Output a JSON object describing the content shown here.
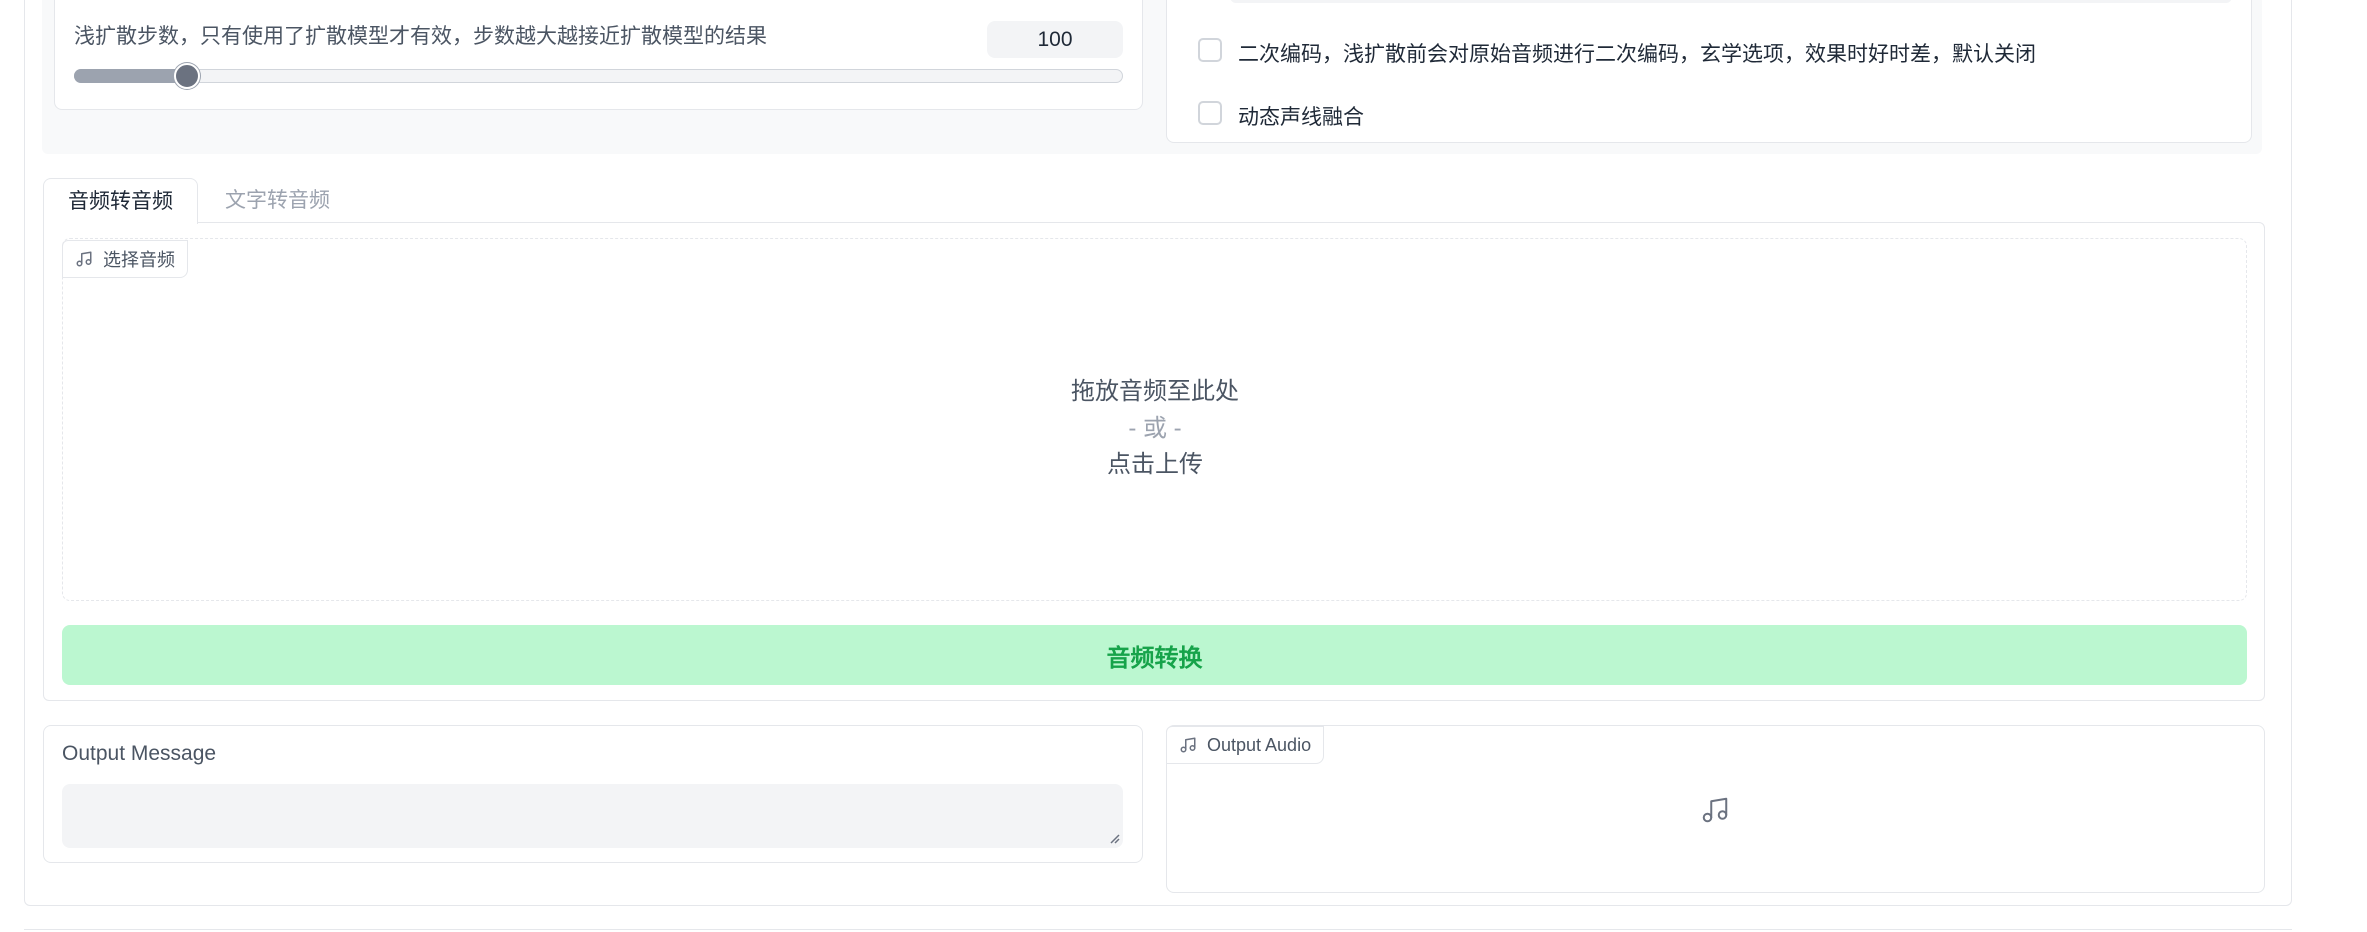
{
  "settings": {
    "shallow_steps": {
      "label": "浅扩散步数，只有使用了扩散模型才有效，步数越大越接近扩散模型的结果",
      "value": "100",
      "slider_fraction": 0.108
    },
    "checkboxes": [
      {
        "label": "二次编码，浅扩散前会对原始音频进行二次编码，玄学选项，效果时好时差，默认关闭",
        "checked": false
      },
      {
        "label": "动态声线融合",
        "checked": false
      }
    ]
  },
  "tabs": [
    {
      "label": "音频转音频",
      "active": true
    },
    {
      "label": "文字转音频",
      "active": false
    }
  ],
  "upload": {
    "chip_label": "选择音频",
    "chip_icon": "music-note-icon",
    "drop_text": "拖放音频至此处",
    "or_text": "- 或 -",
    "click_text": "点击上传"
  },
  "convert_button": {
    "label": "音频转换"
  },
  "output_message": {
    "label": "Output Message",
    "value": ""
  },
  "output_audio": {
    "label": "Output Audio",
    "icon": "music-note-icon"
  },
  "colors": {
    "accent_button_bg": "#bbf7d0",
    "accent_button_text": "#16a34a",
    "border": "#e5e7eb",
    "input_bg": "#f3f4f6"
  }
}
